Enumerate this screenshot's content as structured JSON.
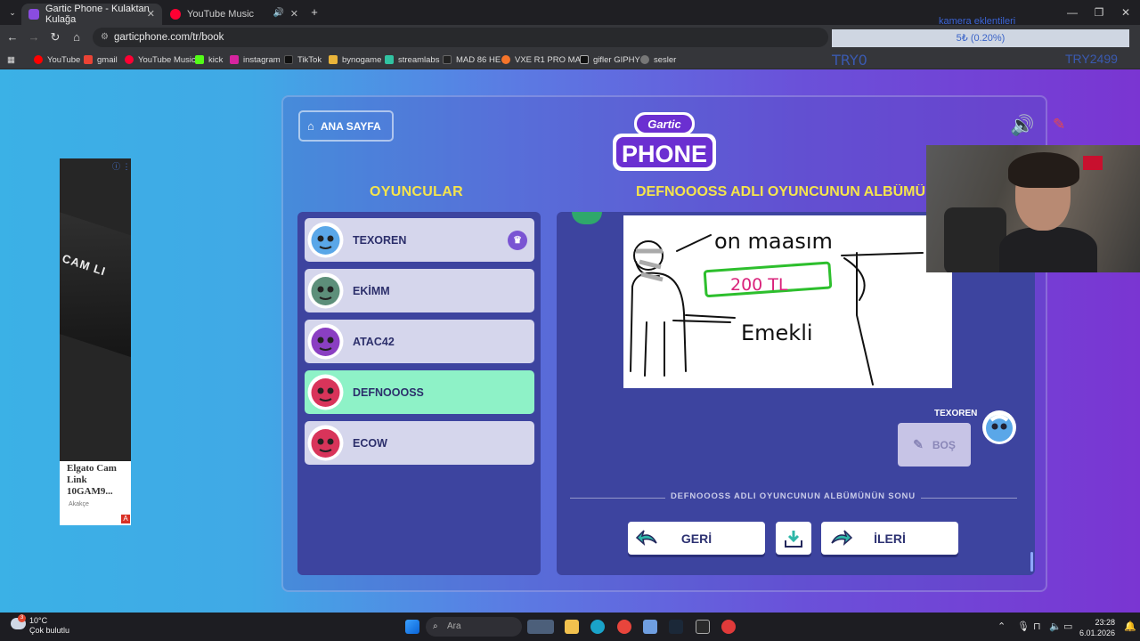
{
  "browser": {
    "tabs": [
      {
        "title": "Gartic Phone - Kulaktan Kulağa",
        "active": true
      },
      {
        "title": "YouTube Music",
        "active": false
      }
    ],
    "url": "garticphone.com/tr/book",
    "bookmarks": [
      "YouTube",
      "gmail",
      "YouTube Music",
      "kick",
      "instagram",
      "TikTok",
      "bynogame",
      "streamlabs",
      "MAD 86 HE",
      "VXE R1 PRO MAX",
      "gifler GIPHY",
      "sesler"
    ],
    "new_tab": "+"
  },
  "overlay": {
    "goal_title": "kamera eklentileri",
    "goal_progress": "5₺ (0.20%)",
    "try_text": "TRY0",
    "try2_text": "TRY2499"
  },
  "ad": {
    "caption": "Elgato Cam Link 10GAM9...",
    "source": "Akakçe",
    "badge": "A",
    "product_word": "CAM LI"
  },
  "game": {
    "home_label": "ANA SAYFA",
    "logo_top": "Gartic",
    "logo_bottom": "PHONE",
    "players_heading": "OYUNCULAR",
    "album_heading": "DEFNOOOSS ADLI OYUNCUNUN ALBÜMÜ",
    "players": [
      {
        "name": "TEXOREN",
        "host": true,
        "selected": false,
        "color": "#5aa7e8"
      },
      {
        "name": "EKİMM",
        "host": false,
        "selected": false,
        "color": "#5d8f7a"
      },
      {
        "name": "ATAC42",
        "host": false,
        "selected": false,
        "color": "#8a3fc2"
      },
      {
        "name": "DEFNOOOSS",
        "host": false,
        "selected": true,
        "color": "#d8345a"
      },
      {
        "name": "ECOW",
        "host": false,
        "selected": false,
        "color": "#d8345a"
      }
    ],
    "drawing_texts": {
      "top": "on maasım",
      "box": "200 TL",
      "bottom": "Emekli"
    },
    "reply_author": "TEXOREN",
    "reply_label": "BOŞ",
    "end_text": "DEFNOOOSS ADLI OYUNCUNUN ALBÜMÜNÜN SONU",
    "back_label": "GERİ",
    "next_label": "İLERİ"
  },
  "taskbar": {
    "weather_temp": "10°C",
    "weather_desc": "Çok bulutlu",
    "weather_badge": "3",
    "search_placeholder": "Ara",
    "time": "23:28",
    "date": "6.01.2026"
  }
}
